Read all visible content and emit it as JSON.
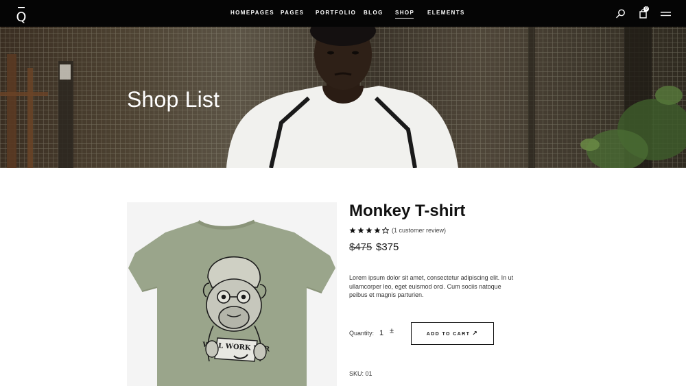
{
  "header": {
    "logo_letter": "Q",
    "nav": [
      "HOMEPAGES",
      "PAGES",
      "PORTFOLIO",
      "BLOG",
      "SHOP",
      "ELEMENTS"
    ],
    "active_nav": "SHOP",
    "cart_count": "0",
    "icons": [
      "search-icon",
      "cart-icon",
      "menu-icon"
    ]
  },
  "hero": {
    "title": "Shop List"
  },
  "product": {
    "name": "Monkey T-shirt",
    "rating": 4,
    "rating_max": 5,
    "review_link": "(1 customer review)",
    "price_old": "$475",
    "price_new": "$375",
    "description": "Lorem ipsum dolor sit amet, consectetur adipiscing elit. In ut ullamcorper leo, eget euismod orci. Cum sociis natoque peibus et magnis parturien.",
    "quantity_label": "Quantity:",
    "quantity_value": "1",
    "quantity_stepper": "±",
    "add_to_cart_label": "ADD TO CART",
    "sku": "SKU: 01",
    "tshirt_print_text": "WILL WORK FOR",
    "colors": {
      "tshirt": "#9aa58b",
      "image_bg": "#f4f4f4"
    }
  }
}
